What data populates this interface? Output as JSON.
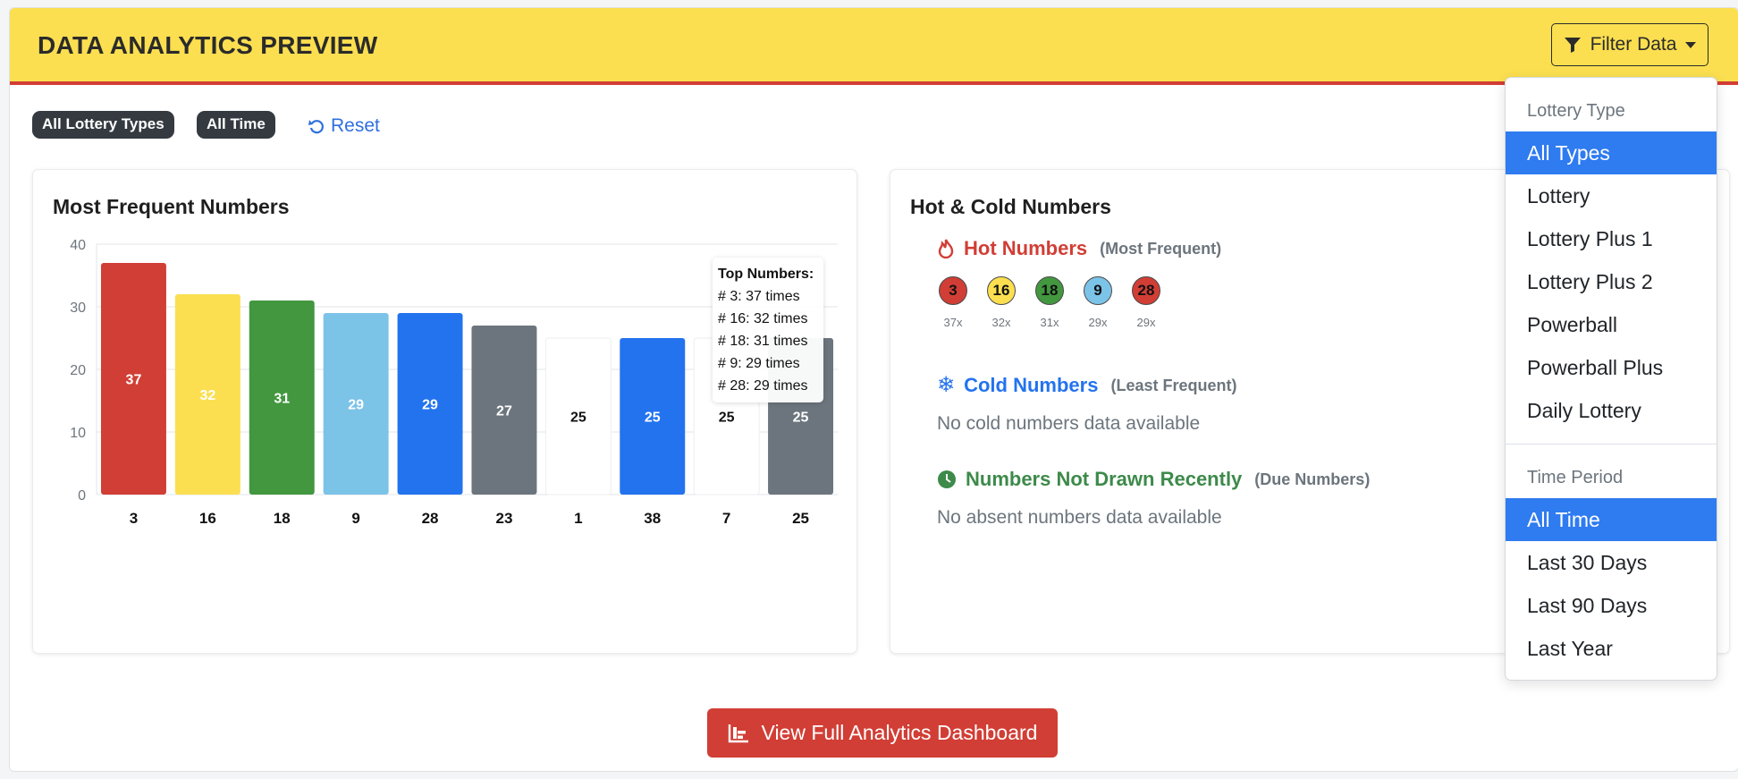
{
  "header": {
    "title": "DATA ANALYTICS PREVIEW",
    "filter_button_label": "Filter Data"
  },
  "active_filters": {
    "chips": [
      "All Lottery Types",
      "All Time"
    ],
    "reset_label": "Reset"
  },
  "frequent_card": {
    "title": "Most Frequent Numbers",
    "tooltip": {
      "title": "Top Numbers:",
      "lines": [
        "# 3: 37 times",
        "# 16: 32 times",
        "# 18: 31 times",
        "# 9: 29 times",
        "# 28: 29 times"
      ]
    }
  },
  "chart_data": {
    "type": "bar",
    "categories": [
      "3",
      "16",
      "18",
      "9",
      "28",
      "23",
      "1",
      "38",
      "7",
      "25"
    ],
    "values": [
      37,
      32,
      31,
      29,
      29,
      27,
      25,
      25,
      25,
      25
    ],
    "ylim": [
      0,
      40
    ],
    "yticks": [
      0,
      10,
      20,
      30,
      40
    ],
    "grid": true,
    "bar_colors": [
      "#d13e35",
      "#fbdf50",
      "#43973f",
      "#7cc3e8",
      "#2373ef",
      "#6c757d",
      "#ffffff",
      "#2373ef",
      "#ffffff",
      "#6c757d"
    ],
    "label_colors": [
      "#ffffff",
      "#ffffff",
      "#ffffff",
      "#ffffff",
      "#ffffff",
      "#ffffff",
      "#111111",
      "#ffffff",
      "#111111",
      "#ffffff"
    ]
  },
  "hotcold_card": {
    "title": "Hot & Cold Numbers",
    "hot": {
      "label": "Hot Numbers",
      "sub": "(Most Frequent)",
      "color": "#d13e35",
      "balls": [
        {
          "number": "3",
          "count": "37x",
          "color": "#d13e35"
        },
        {
          "number": "16",
          "count": "32x",
          "color": "#fbdf50"
        },
        {
          "number": "18",
          "count": "31x",
          "color": "#43973f"
        },
        {
          "number": "9",
          "count": "29x",
          "color": "#7cc3e8"
        },
        {
          "number": "28",
          "count": "29x",
          "color": "#d13e35"
        }
      ]
    },
    "cold": {
      "label": "Cold Numbers",
      "sub": "(Least Frequent)",
      "color": "#2373ef",
      "empty": "No cold numbers data available"
    },
    "due": {
      "label": "Numbers Not Drawn Recently",
      "sub": "(Due Numbers)",
      "color": "#3d8a4a",
      "empty": "No absent numbers data available"
    }
  },
  "filter_menu": {
    "type_header": "Lottery Type",
    "type_items": [
      "All Types",
      "Lottery",
      "Lottery Plus 1",
      "Lottery Plus 2",
      "Powerball",
      "Powerball Plus",
      "Daily Lottery"
    ],
    "type_active": "All Types",
    "period_header": "Time Period",
    "period_items": [
      "All Time",
      "Last 30 Days",
      "Last 90 Days",
      "Last Year"
    ],
    "period_active": "All Time"
  },
  "cta": {
    "label": "View Full Analytics Dashboard"
  }
}
